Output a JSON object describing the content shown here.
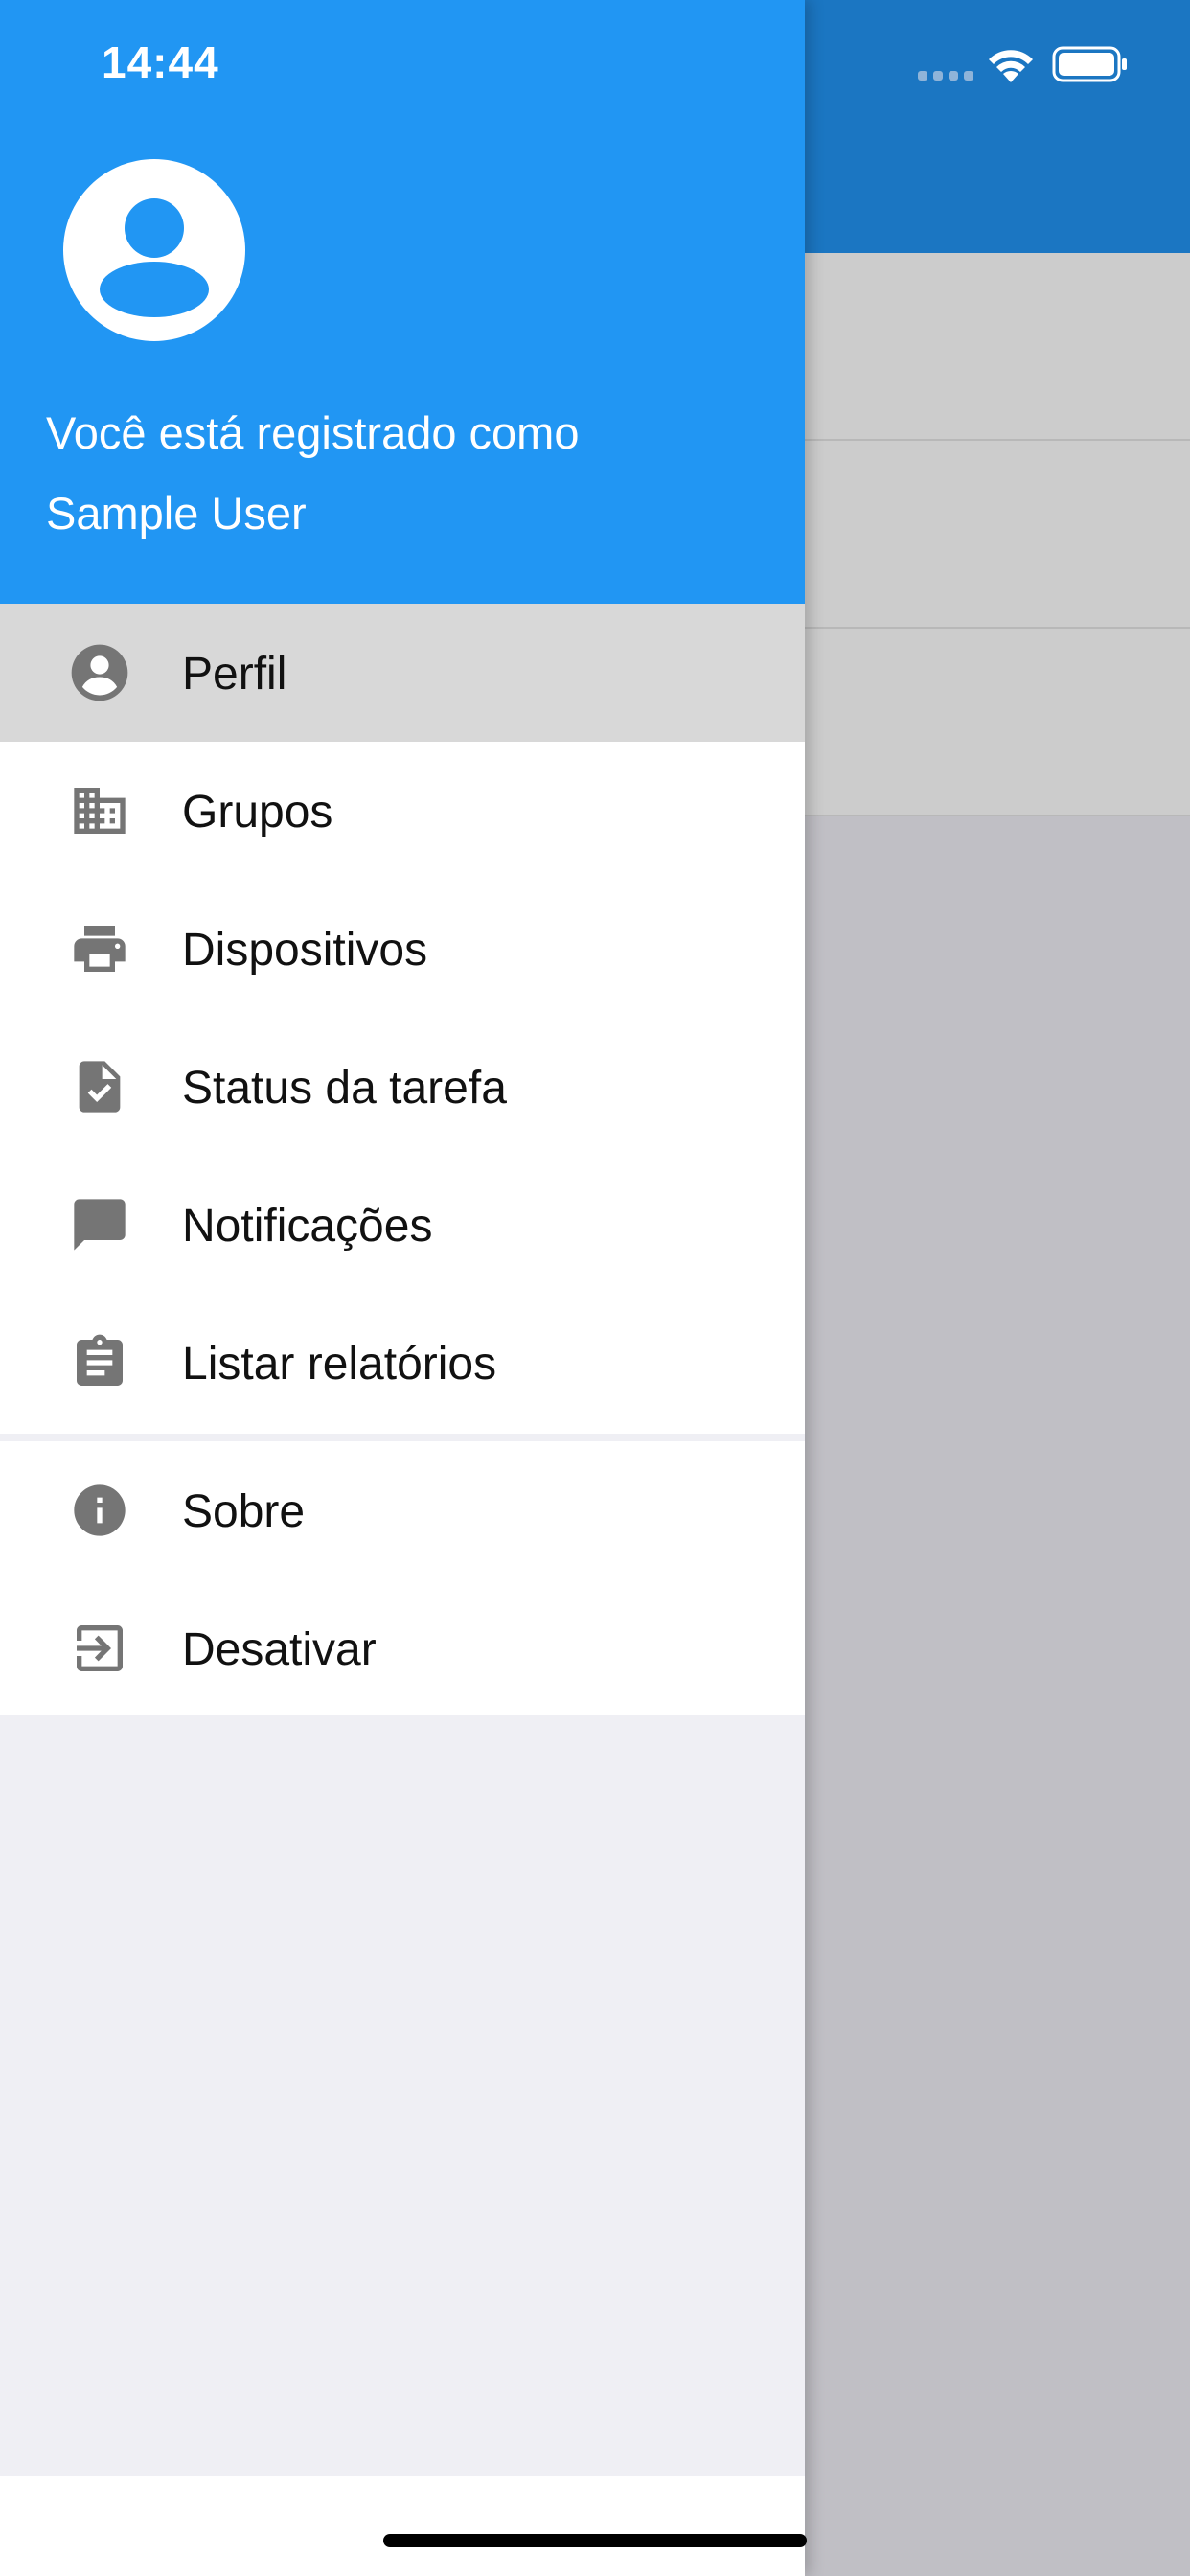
{
  "status_bar": {
    "time": "14:44",
    "icons": [
      "signal-icon",
      "wifi-icon",
      "battery-icon"
    ]
  },
  "drawer": {
    "header": {
      "line1": "Você está registrado como",
      "line2": "Sample User",
      "avatar_icon": "account-circle-icon"
    },
    "menu_group_1": [
      {
        "label": "Perfil",
        "icon": "account-circle-icon",
        "selected": true
      },
      {
        "label": "Grupos",
        "icon": "building-icon"
      },
      {
        "label": "Dispositivos",
        "icon": "printer-icon"
      },
      {
        "label": "Status da tarefa",
        "icon": "file-check-icon"
      },
      {
        "label": "Notificações",
        "icon": "chat-bubble-icon"
      },
      {
        "label": "Listar relatórios",
        "icon": "clipboard-icon"
      }
    ],
    "menu_group_2": [
      {
        "label": "Sobre",
        "icon": "info-icon"
      },
      {
        "label": "Desativar",
        "icon": "exit-icon"
      }
    ]
  },
  "colors": {
    "drawer_header": "#2196f3",
    "app_header": "#1b76c2",
    "icon_gray": "#757575",
    "selected_row": "#d8d8d8"
  }
}
